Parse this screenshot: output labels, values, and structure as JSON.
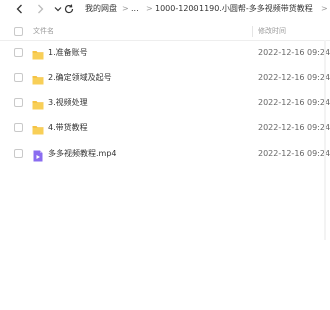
{
  "toolbar": {
    "back_icon": "chevron-left-icon",
    "forward_icon": "chevron-right-icon",
    "refresh_icon": "refresh-icon",
    "breadcrumb": [
      "我的网盘",
      "...",
      "1000-1200",
      "1190.小圆帮-多多视频带货教程"
    ],
    "separator": ">"
  },
  "header": {
    "name_col": "文件名",
    "date_col": "修改时间"
  },
  "files": [
    {
      "name": "1.准备账号",
      "date": "2022-12-16 09:24",
      "icon": "folder-icon"
    },
    {
      "name": "2.确定领域及起号",
      "date": "2022-12-16 09:24",
      "icon": "folder-icon"
    },
    {
      "name": "3.视频处理",
      "date": "2022-12-16 09:24",
      "icon": "folder-icon"
    },
    {
      "name": "4.带货教程",
      "date": "2022-12-16 09:24",
      "icon": "folder-icon"
    },
    {
      "name": "多多视频教程.mp4",
      "date": "2022-12-16 09:24",
      "icon": "video-file-icon"
    }
  ],
  "colors": {
    "folder": "#F5C344",
    "video": "#8A6CF0",
    "muted": "#999999"
  }
}
